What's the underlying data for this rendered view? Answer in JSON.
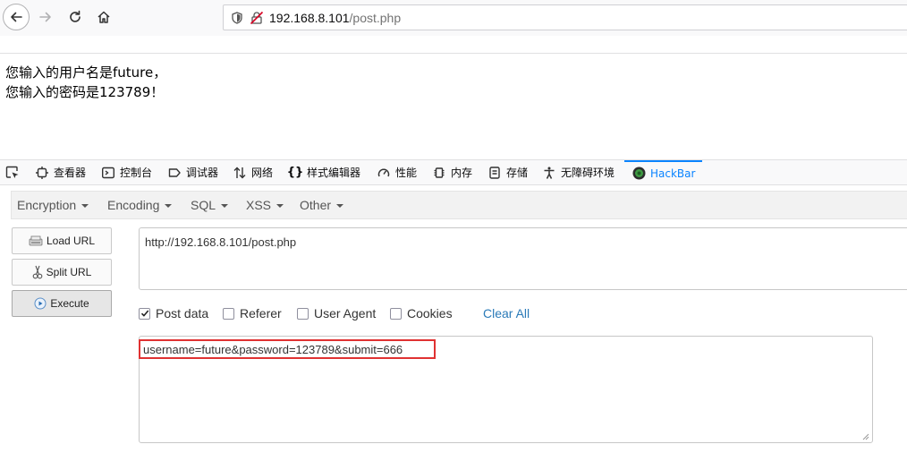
{
  "browser": {
    "url_host": "192.168.8.101",
    "url_path": "/post.php"
  },
  "page": {
    "line1": "您输入的用户名是future，",
    "line2": "您输入的密码是123789！"
  },
  "devtools": {
    "tabs": [
      {
        "label": "查看器",
        "icon": "inspector-icon"
      },
      {
        "label": "控制台",
        "icon": "console-icon"
      },
      {
        "label": "调试器",
        "icon": "debugger-icon"
      },
      {
        "label": "网络",
        "icon": "network-icon"
      },
      {
        "label": "样式编辑器",
        "icon": "style-editor-icon"
      },
      {
        "label": "性能",
        "icon": "performance-icon"
      },
      {
        "label": "内存",
        "icon": "memory-icon"
      },
      {
        "label": "存储",
        "icon": "storage-icon"
      },
      {
        "label": "无障碍环境",
        "icon": "accessibility-icon"
      },
      {
        "label": "HackBar",
        "icon": "hackbar-icon",
        "active": true
      }
    ],
    "accent_color": "#0a84ff"
  },
  "hackbar": {
    "menus": [
      "Encryption",
      "Encoding",
      "SQL",
      "XSS",
      "Other"
    ],
    "buttons": {
      "load_url": "Load URL",
      "split_url": "Split URL",
      "execute": "Execute"
    },
    "url_value": "http://192.168.8.101/post.php",
    "options": [
      {
        "label": "Post data",
        "checked": true
      },
      {
        "label": "Referer",
        "checked": false
      },
      {
        "label": "User Agent",
        "checked": false
      },
      {
        "label": "Cookies",
        "checked": false
      }
    ],
    "clear_all": "Clear All",
    "post_data": "username=future&password=123789&submit=666",
    "highlight_color": "#e03232"
  }
}
